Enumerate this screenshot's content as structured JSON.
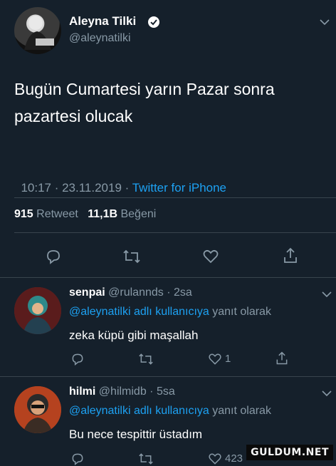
{
  "main_tweet": {
    "display_name": "Aleyna Tilki",
    "handle": "@aleynatilki",
    "text_line1": "Bugün Cumartesi yarın Pazar sonra",
    "text_line2": "pazartesi olucak",
    "timestamp": "10:17 · 23.11.2019 · ",
    "source": "Twitter for iPhone",
    "retweet_count": "915",
    "retweet_label": "Retweet",
    "like_count": "11,1B",
    "like_label": "Beğeni"
  },
  "replies": [
    {
      "display_name": "senpai",
      "meta": "@rulannds · 2sa",
      "reply_to_mention": "@aleynatilki adlı kullanıcıya",
      "reply_to_suffix": "yanıt olarak",
      "text": "zeka küpü gibi maşallah",
      "like_count": "1"
    },
    {
      "display_name": "hilmi",
      "meta": "@hilmidb · 5sa",
      "reply_to_mention": "@aleynatilki adlı kullanıcıya",
      "reply_to_suffix": "yanıt olarak",
      "text": "Bu nece tespittir üstadım",
      "like_count": "423"
    }
  ],
  "watermark": "GULDUM.NET",
  "icons": [
    "chevron-down-icon",
    "verified-badge-icon",
    "reply-icon",
    "retweet-icon",
    "like-icon",
    "share-icon"
  ],
  "colors": {
    "background": "#15202b",
    "accent": "#1da1f2",
    "muted": "#8899a6",
    "text": "#e8ecef"
  }
}
